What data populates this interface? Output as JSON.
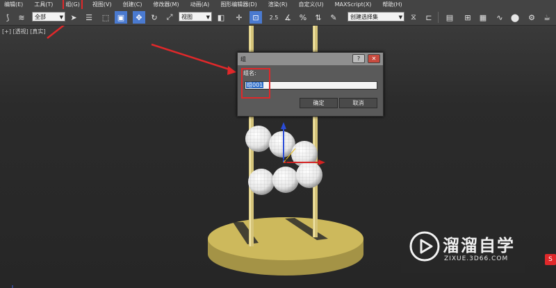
{
  "menubar": {
    "items": [
      "编辑(E)",
      "工具(T)",
      "组(G)",
      "视图(V)",
      "创建(C)",
      "修改器(M)",
      "动画(A)",
      "图形编辑器(D)",
      "渲染(R)",
      "自定义(U)",
      "MAXScript(X)",
      "帮助(H)"
    ]
  },
  "toolbar": {
    "filter_select": "全部",
    "coord_select": "视图",
    "selection_set_select": "创建选择集",
    "snap_value": "2.5"
  },
  "viewport": {
    "label": "[+] [透视] [真实]"
  },
  "dialog": {
    "title": "组",
    "help_label": "?",
    "close_label": "✕",
    "name_label": "组名:",
    "name_value": "组001",
    "ok_label": "确定",
    "cancel_label": "取消"
  },
  "watermark": {
    "text": "溜溜自学",
    "url": "ZIXUE.3D66.COM"
  },
  "side_badge": "S",
  "colors": {
    "highlight": "#e0282a",
    "platform": "#c8b55a",
    "pole": "#d9c97c",
    "selection": "#2f6ec8"
  }
}
